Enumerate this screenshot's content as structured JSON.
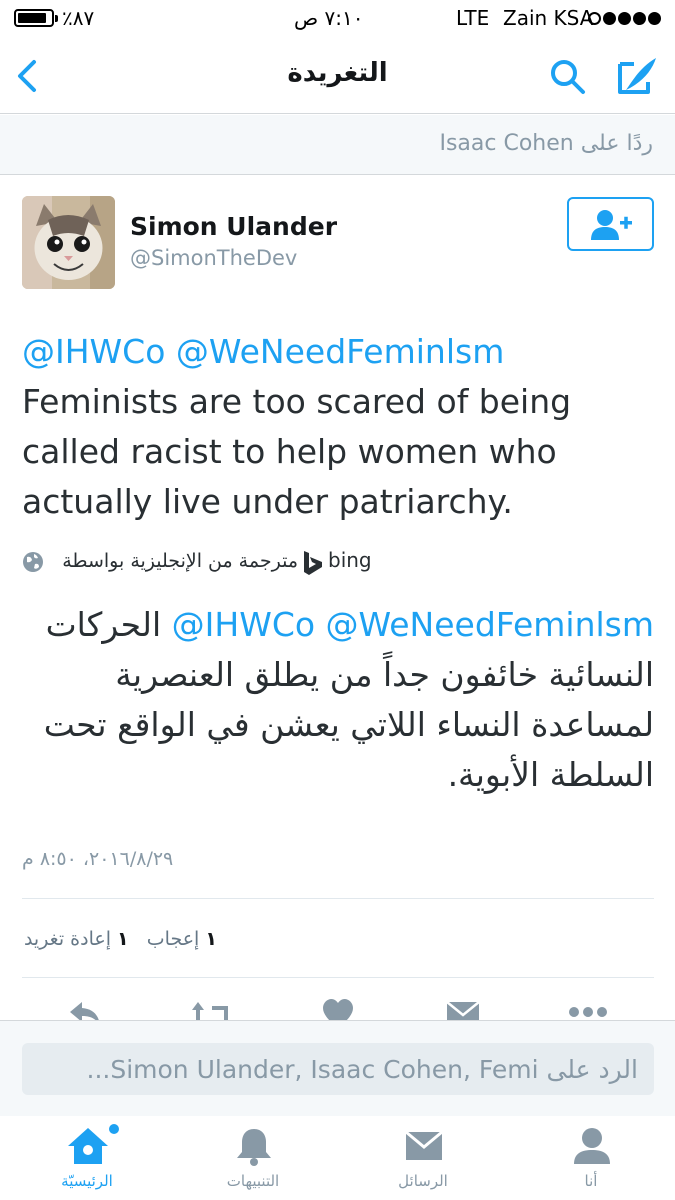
{
  "status_bar": {
    "battery_text": "٪٨٧",
    "battery_level_percent": 87,
    "time": "٧:١٠ ص",
    "network": "LTE",
    "carrier": "Zain KSA",
    "signal_bars_filled": 4,
    "signal_bars_total": 5
  },
  "nav": {
    "title": "التغريدة",
    "back_icon": "chevron-left-icon",
    "search_icon": "search-icon",
    "compose_icon": "compose-tweet-icon"
  },
  "reply_context": {
    "text": "ردًا على  Isaac Cohen"
  },
  "tweet": {
    "author": {
      "display_name": "Simon Ulander",
      "handle": "@SimonTheDev"
    },
    "follow_icon": "follow-user-icon",
    "mentions": "@IHWCo @WeNeedFeminlsm",
    "text": "Feminists are too scared of being called racist to help women who actually live under patriarchy.",
    "translation": {
      "label": "مترجمة من الإنجليزية بواسطة",
      "provider": "bing",
      "translated_text": "الحركات النسائية خائفون جداً من يطلق العنصرية لمساعدة النساء اللاتي يعشن في الواقع تحت السلطة الأبوية."
    },
    "timestamp": "٢٠١٦/٨/٢٩، ٨:٥٠ م",
    "stats": {
      "likes_count": "١",
      "likes_label": "إعجاب",
      "retweets_count": "١",
      "retweets_label": "إعادة تغريد"
    }
  },
  "composer": {
    "placeholder": "الرد على Simon Ulander, Isaac Cohen, Femi..."
  },
  "tab_bar": {
    "tabs": [
      {
        "label": "الرئيسيّة",
        "icon": "home-icon",
        "active": true
      },
      {
        "label": "التنبيهات",
        "icon": "bell-icon",
        "active": false
      },
      {
        "label": "الرسائل",
        "icon": "mail-icon",
        "active": false
      },
      {
        "label": "أنا",
        "icon": "profile-icon",
        "active": false
      }
    ]
  },
  "colors": {
    "accent": "#1da1f2",
    "text": "#292f33",
    "muted": "#8899a6",
    "background_alt": "#f5f8fa"
  }
}
